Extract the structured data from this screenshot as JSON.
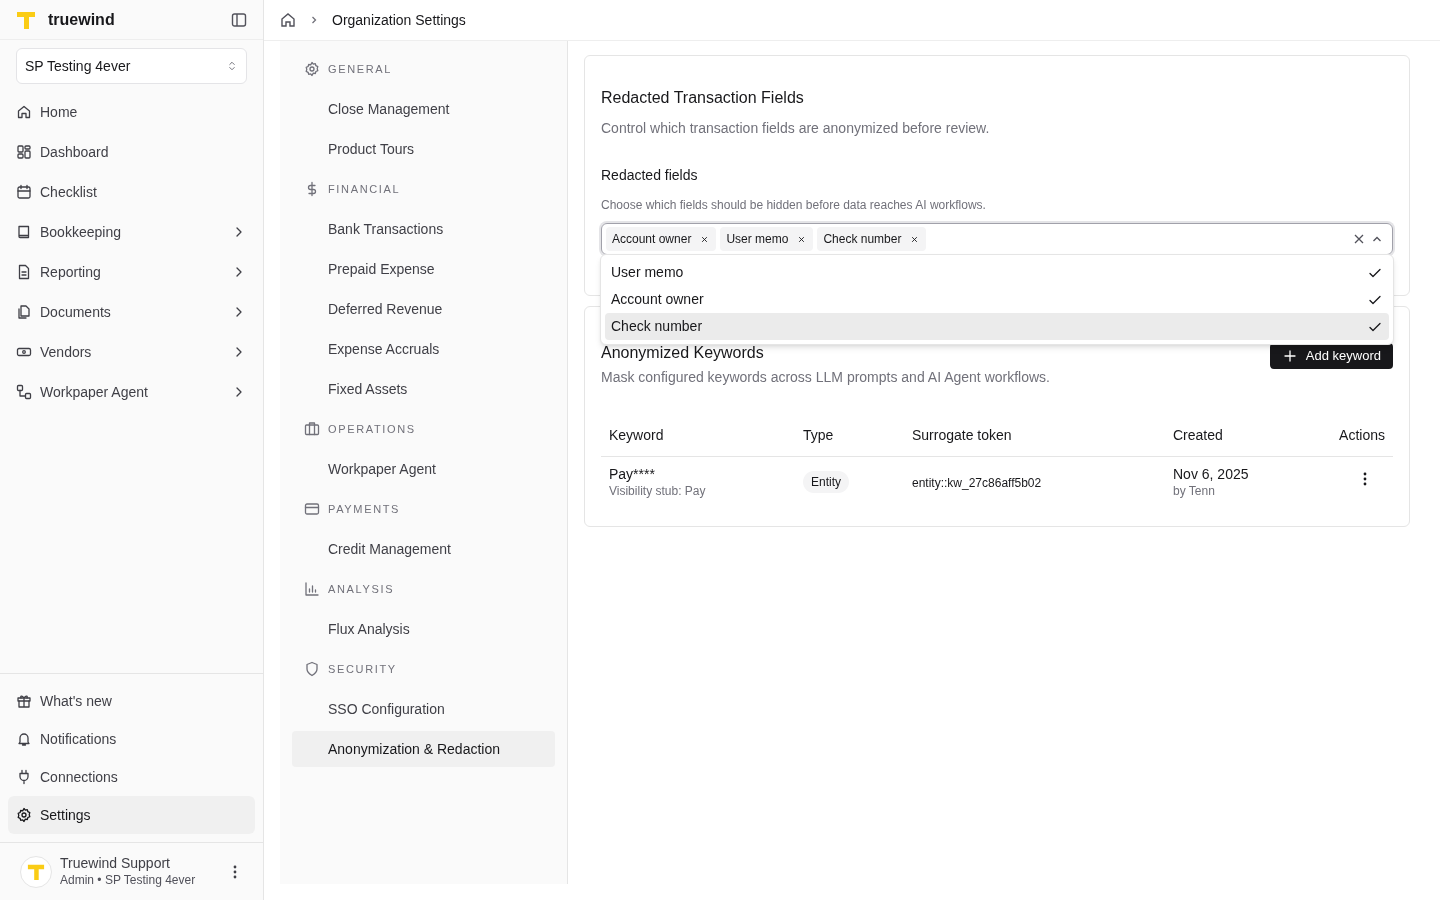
{
  "sidebar": {
    "brand": "truewind",
    "org_selector": "SP Testing 4ever",
    "nav": [
      {
        "label": "Home",
        "expandable": false
      },
      {
        "label": "Dashboard",
        "expandable": false
      },
      {
        "label": "Checklist",
        "expandable": false
      },
      {
        "label": "Bookkeeping",
        "expandable": true
      },
      {
        "label": "Reporting",
        "expandable": true
      },
      {
        "label": "Documents",
        "expandable": true
      },
      {
        "label": "Vendors",
        "expandable": true
      },
      {
        "label": "Workpaper Agent",
        "expandable": true
      }
    ],
    "footer_nav": [
      {
        "label": "What's new",
        "selected": false
      },
      {
        "label": "Notifications",
        "selected": false
      },
      {
        "label": "Connections",
        "selected": false
      },
      {
        "label": "Settings",
        "selected": true
      }
    ],
    "user": {
      "name": "Truewind Support",
      "subtitle": "Admin • SP Testing 4ever"
    }
  },
  "breadcrumb": {
    "current": "Organization Settings"
  },
  "settings_nav": [
    {
      "heading": "GENERAL",
      "items": [
        {
          "label": "Close Management",
          "selected": false
        },
        {
          "label": "Product Tours",
          "selected": false
        }
      ]
    },
    {
      "heading": "FINANCIAL",
      "items": [
        {
          "label": "Bank Transactions",
          "selected": false
        },
        {
          "label": "Prepaid Expense",
          "selected": false
        },
        {
          "label": "Deferred Revenue",
          "selected": false
        },
        {
          "label": "Expense Accruals",
          "selected": false
        },
        {
          "label": "Fixed Assets",
          "selected": false
        }
      ]
    },
    {
      "heading": "OPERATIONS",
      "items": [
        {
          "label": "Workpaper Agent",
          "selected": false
        }
      ]
    },
    {
      "heading": "PAYMENTS",
      "items": [
        {
          "label": "Credit Management",
          "selected": false
        }
      ]
    },
    {
      "heading": "ANALYSIS",
      "items": [
        {
          "label": "Flux Analysis",
          "selected": false
        }
      ]
    },
    {
      "heading": "SECURITY",
      "items": [
        {
          "label": "SSO Configuration",
          "selected": false
        },
        {
          "label": "Anonymization & Redaction",
          "selected": true
        }
      ]
    }
  ],
  "redaction_card": {
    "title": "Redacted Transaction Fields",
    "description": "Control which transaction fields are anonymized before review.",
    "field_label": "Redacted fields",
    "field_hint": "Choose which fields should be hidden before data reaches AI workflows.",
    "tags": [
      "Account owner",
      "User memo",
      "Check number"
    ],
    "dropdown_expanded": true,
    "options": [
      {
        "label": "User memo",
        "checked": true,
        "highlighted": false
      },
      {
        "label": "Account owner",
        "checked": true,
        "highlighted": false
      },
      {
        "label": "Check number",
        "checked": true,
        "highlighted": true
      }
    ]
  },
  "keywords_card": {
    "title": "Anonymized Keywords",
    "description": "Mask configured keywords across LLM prompts and AI Agent workflows.",
    "add_button": "Add keyword",
    "columns": [
      "Keyword",
      "Type",
      "Surrogate token",
      "Created",
      "Actions"
    ],
    "rows": [
      {
        "keyword": "Pay****",
        "keyword_sub": "Visibility stub: Pay",
        "type": "Entity",
        "token": "entity::kw_27c86aff5b02",
        "created": "Nov 6, 2025",
        "created_by": "by Tenn"
      }
    ]
  }
}
